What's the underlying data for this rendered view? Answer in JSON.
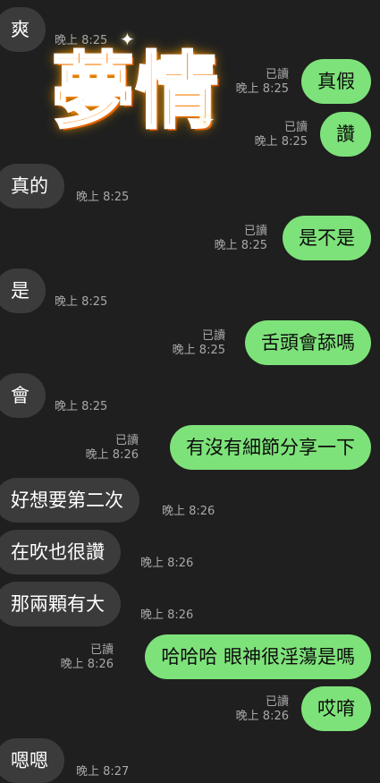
{
  "messages": [
    {
      "side": "in",
      "text": "爽",
      "time": "晚上 8:25"
    },
    {
      "side": "sticker",
      "text": "夢情",
      "time": ""
    },
    {
      "side": "out",
      "text": "真假",
      "read": "已讀",
      "time": "晚上 8:25"
    },
    {
      "side": "out",
      "text": "讚",
      "read": "已讀",
      "time": "晚上 8:25"
    },
    {
      "side": "in",
      "text": "真的",
      "time": "晚上 8:25"
    },
    {
      "side": "out",
      "text": "是不是",
      "read": "已讀",
      "time": "晚上 8:25"
    },
    {
      "side": "in",
      "text": "是",
      "time": "晚上 8:25"
    },
    {
      "side": "out",
      "text": "舌頭會舔嗎",
      "read": "已讀",
      "time": "晚上 8:25"
    },
    {
      "side": "in",
      "text": "會",
      "time": "晚上 8:25"
    },
    {
      "side": "out",
      "text": "有沒有細節分享一下",
      "read": "已讀",
      "time": "晚上 8:26"
    },
    {
      "side": "in",
      "text": "好想要第二次",
      "time": "晚上 8:26"
    },
    {
      "side": "in",
      "text": "在吹也很讚",
      "time": "晚上 8:26"
    },
    {
      "side": "in",
      "text": "那兩顆有大",
      "time": "晚上 8:26"
    },
    {
      "side": "out",
      "text": "哈哈哈 眼神很淫蕩是嗎",
      "read": "已讀",
      "time": "晚上 8:26"
    },
    {
      "side": "out",
      "text": "哎唷",
      "read": "已讀",
      "time": "晚上 8:26"
    },
    {
      "side": "in",
      "text": "嗯嗯",
      "time": "晚上 8:27"
    }
  ],
  "colors": {
    "background": "#1f1f1f",
    "incoming": "#3b3b3b",
    "outgoing": "#7ee27a",
    "meta": "#a8a8a8",
    "sticker": "#ff7a00"
  }
}
